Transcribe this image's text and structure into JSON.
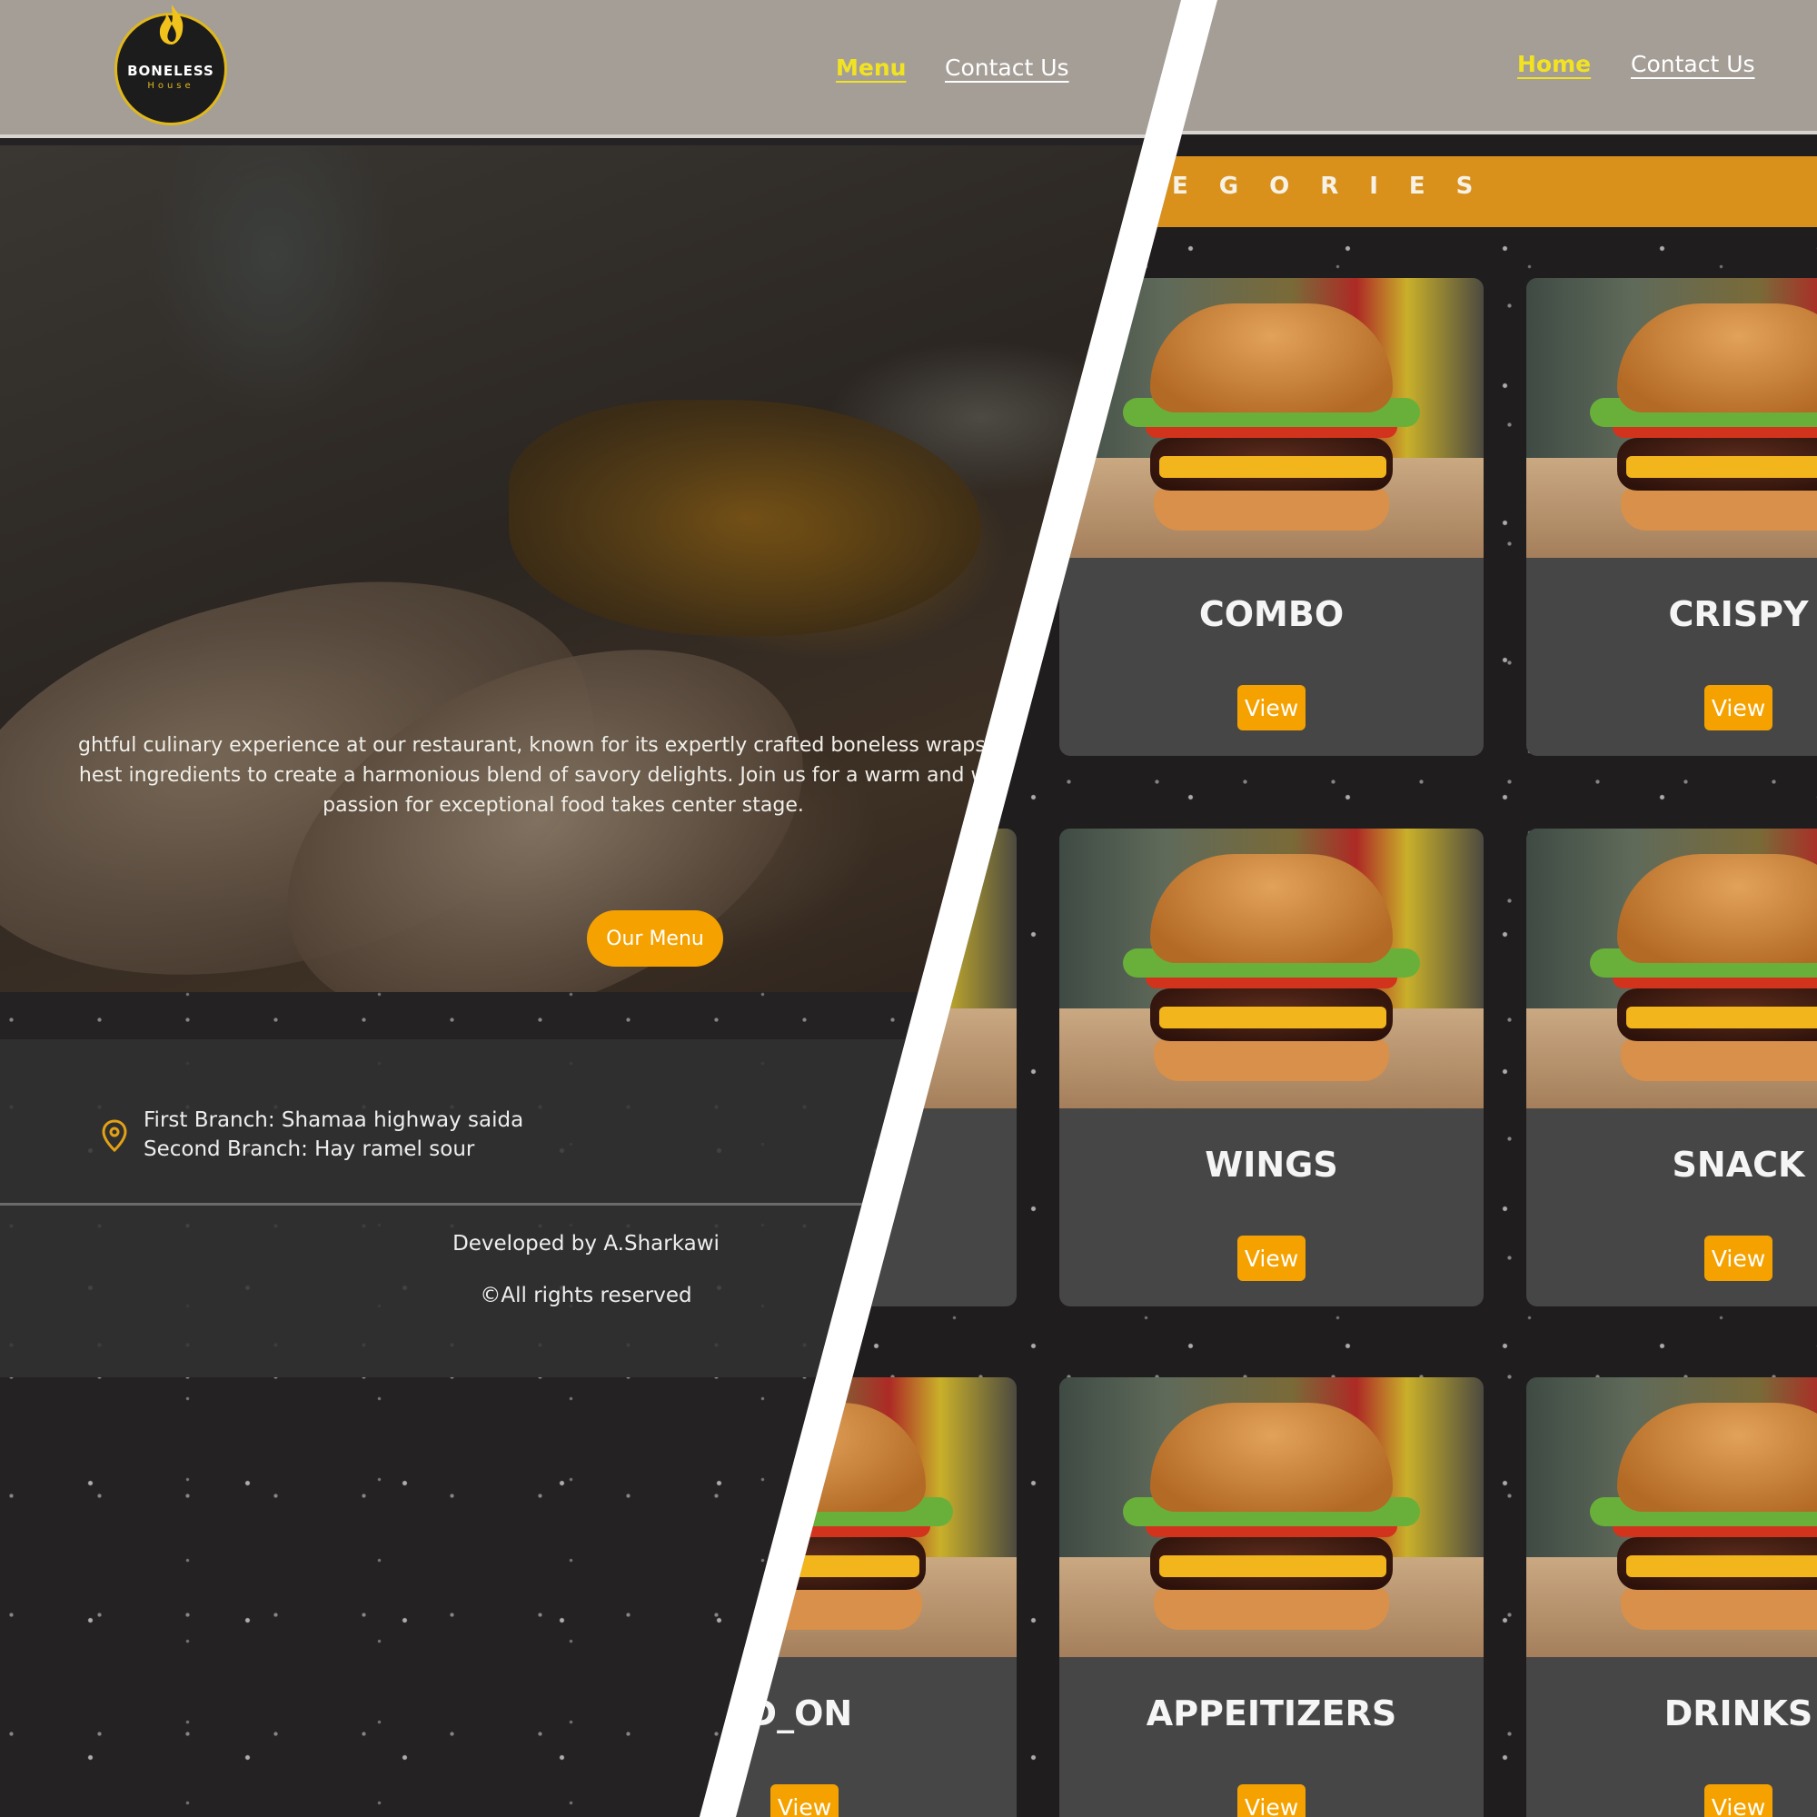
{
  "left_page": {
    "logo": {
      "name": "BONELESS",
      "sub": "House"
    },
    "nav": {
      "active": "Menu",
      "contact": "Contact Us"
    },
    "hero": {
      "line1": "ghtful culinary experience at our restaurant, known for its expertly crafted boneless wraps and fl",
      "line2": "hest ingredients to create a harmonious blend of savory delights. Join us for a warm and welcom",
      "line3": "passion for exceptional food takes center stage.",
      "button": "Our Menu"
    },
    "footer": {
      "branch1": "First Branch: Shamaa highway saida",
      "branch2": "Second Branch: Hay ramel sour",
      "developed": "Developed by A.Sharkawi",
      "rights": "©All rights reserved"
    }
  },
  "right_page": {
    "nav": {
      "active": "Home",
      "contact": "Contact Us"
    },
    "categories_title": "EGORIES",
    "view_label": "View",
    "cards": [
      {
        "title": "COMBO"
      },
      {
        "title": "CRISPY"
      },
      {
        "title": "WINGS"
      },
      {
        "title": "SNACK"
      },
      {
        "title": "DD_ON"
      },
      {
        "title": "APPEITIZERS"
      },
      {
        "title": "DRINKS"
      }
    ]
  },
  "colors": {
    "accent": "#f5a200",
    "nav_active": "#f2e322",
    "navbar": "#a59e97",
    "category_band": "#d9911c"
  }
}
